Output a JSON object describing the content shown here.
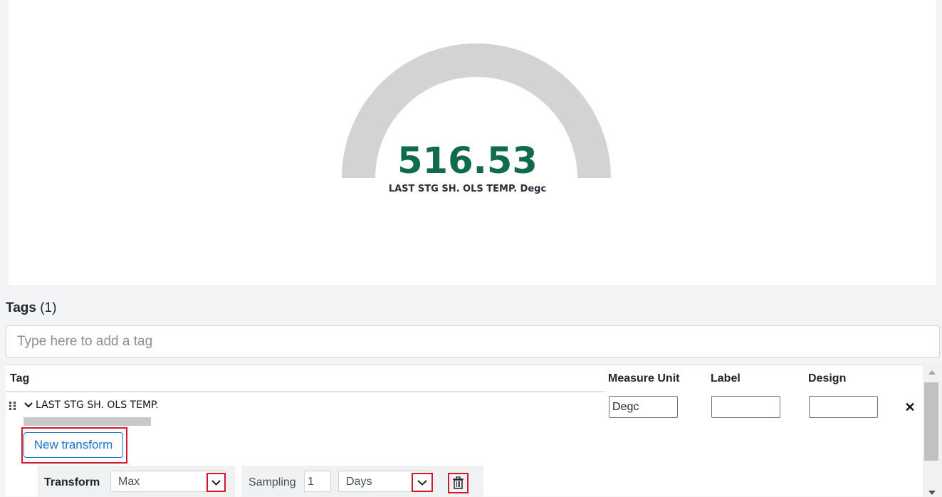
{
  "gauge": {
    "value": "516.53",
    "label": "LAST STG SH. OLS TEMP. Degc",
    "fill_fraction": 0,
    "track_color": "#d3d3d3",
    "value_color": "#0f6b49"
  },
  "tags": {
    "title": "Tags",
    "count": "(1)",
    "input_placeholder": "Type here to add a tag"
  },
  "table": {
    "headers": {
      "tag": "Tag",
      "measure_unit": "Measure Unit",
      "label": "Label",
      "design": "Design"
    },
    "rows": [
      {
        "tag_name": "LAST STG SH. OLS TEMP.",
        "measure_unit": "Degc",
        "label": "",
        "design": ""
      }
    ]
  },
  "transform": {
    "new_button_label": "New transform",
    "transform_label": "Transform",
    "transform_value": "Max",
    "sampling_label": "Sampling",
    "sampling_amount": "1",
    "sampling_unit": "Days"
  },
  "icons": {
    "drag": "drag-handle-icon",
    "expand": "chevron-down-icon",
    "remove": "close-icon",
    "delete": "trash-icon"
  },
  "colors": {
    "highlight": "#d0192b",
    "link": "#1a73c8"
  }
}
